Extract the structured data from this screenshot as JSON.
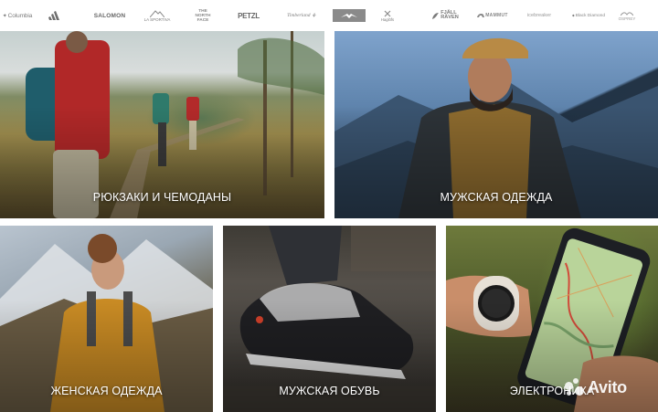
{
  "brands": {
    "columbia": "Columbia",
    "adidas": "",
    "salomon": "SALOMON",
    "lasportiva_line1": "LA SPORTIVA",
    "tnf_line1": "THE",
    "tnf_line2": "NORTH",
    "tnf_line3": "FACE",
    "petzl": "PETZL",
    "timberland": "Timberland",
    "haglofs": "Haglöfs",
    "fjallraven_line1": "FJÄLL",
    "fjallraven_line2": "RÄVEN",
    "mammut": "MAMMUT",
    "icebreaker": "icebreaker",
    "blackdiamond": "Black Diamond",
    "osprey": "OSPREY",
    "icons": {
      "adidas": "adidas-stripes-icon",
      "lasportiva": "mountain-logo-icon",
      "salewa": "salewa-eagle-logo",
      "haglofs": "haglofs-logo-icon",
      "fjallraven": "fox-logo-icon",
      "mammut": "mammoth-logo-icon",
      "blackdiamond": "diamond-logo-icon",
      "osprey": "osprey-bird-logo-icon"
    }
  },
  "categories": [
    {
      "label": "РЮКЗАКИ И ЧЕМОДАНЫ"
    },
    {
      "label": "МУЖСКАЯ ОДЕЖДА"
    },
    {
      "label": "ЖЕНСКАЯ ОДЕЖДА"
    },
    {
      "label": "МУЖСКАЯ ОБУВЬ"
    },
    {
      "label": "ЭЛЕКТРОНИКА"
    }
  ],
  "watermark": {
    "text": "Avito"
  },
  "colors": {
    "label_text": "#ffffff",
    "brand_gray": "#7c7c7c",
    "salewa_box": "#8a8a8a"
  }
}
